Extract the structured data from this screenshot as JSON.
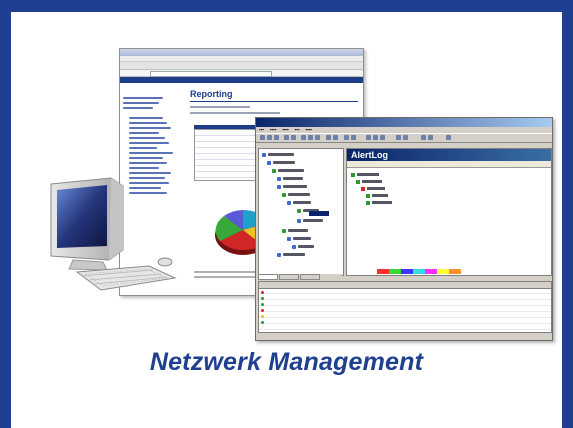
{
  "caption": "Netzwerk Management",
  "browser_window": {
    "page_heading": "Reporting"
  },
  "app_window": {
    "panel_heading": "AlertLog"
  },
  "colors": {
    "frame": "#1f3f90",
    "caption": "#1f3f90",
    "status_strip": [
      "#ff3030",
      "#38d838",
      "#3838ff",
      "#30e0e0",
      "#ff30ff",
      "#ffff30",
      "#ff9030"
    ]
  },
  "icons": [
    "desktop-computer-icon",
    "keyboard-icon",
    "mouse-icon",
    "pie-chart-icon",
    "tree-view-icon"
  ]
}
